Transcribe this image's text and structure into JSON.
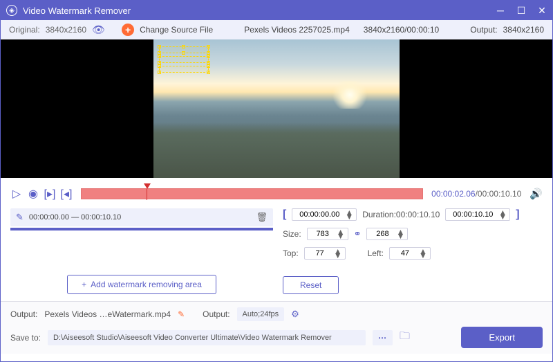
{
  "title": "Video Watermark Remover",
  "toolbar": {
    "original_label": "Original:",
    "original_res": "3840x2160",
    "change_source": "Change Source File",
    "filename": "Pexels Videos 2257025.mp4",
    "file_info": "3840x2160/00:00:10",
    "output_label": "Output:",
    "output_res": "3840x2160"
  },
  "playback": {
    "current": "00:00:02.06",
    "total": "/00:00:10.10"
  },
  "segment": {
    "range": "00:00:00.00 — 00:00:10.10"
  },
  "clip": {
    "start": "00:00:00.00",
    "duration_label": "Duration:",
    "duration": "00:00:10.10",
    "end": "00:00:10.10",
    "size_label": "Size:",
    "width": "783",
    "height": "268",
    "top_label": "Top:",
    "top": "77",
    "left_label": "Left:",
    "left": "47"
  },
  "buttons": {
    "add_area": "Add watermark removing area",
    "reset": "Reset",
    "export": "Export"
  },
  "output": {
    "label1": "Output:",
    "filename": "Pexels Videos …eWatermark.mp4",
    "label2": "Output:",
    "format": "Auto;24fps",
    "save_label": "Save to:",
    "path": "D:\\Aiseesoft Studio\\Aiseesoft Video Converter Ultimate\\Video Watermark Remover"
  }
}
